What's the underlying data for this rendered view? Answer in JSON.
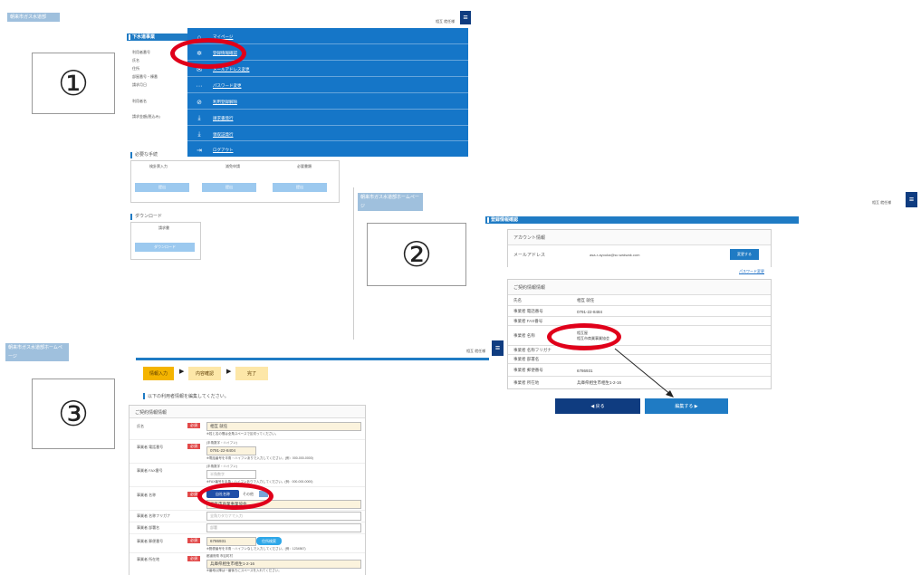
{
  "panel1": {
    "logo": "朝来市ガス水道部",
    "user_text": "相互 就任様",
    "number_label": "①",
    "contract_section_title": "下水道事業",
    "field_labels": [
      "利用者番号",
      "氏名",
      "住所",
      "部屋番号・棟番",
      "請求月日",
      "利用者名",
      "請求金額(税込み)"
    ],
    "menu": [
      {
        "icon": "home-icon",
        "glyph": "⌂",
        "label": "マイページ"
      },
      {
        "icon": "gear-icon",
        "glyph": "✲",
        "label": "登録情報確認"
      },
      {
        "icon": "mail-icon",
        "glyph": "✉",
        "label": "メールアドレス変更"
      },
      {
        "icon": "dots-icon",
        "glyph": "···",
        "label": "パスワード変更"
      },
      {
        "icon": "ban-icon",
        "glyph": "⊘",
        "label": "利用登録解除"
      },
      {
        "icon": "download-icon",
        "glyph": "⤓",
        "label": "請求書発行"
      },
      {
        "icon": "download-icon",
        "glyph": "⤓",
        "label": "領収証発行"
      },
      {
        "icon": "logout-icon",
        "glyph": "⇥",
        "label": "ログアウト"
      }
    ],
    "procedures_title": "必要な手続",
    "procedures_cols": [
      "検針票入力",
      "減免申請",
      "必要書類"
    ],
    "procedures_buttons": [
      "提出",
      "提出",
      "提出"
    ],
    "download_title": "ダウンロード",
    "download_col": "請求書",
    "download_button": "ダウンロード"
  },
  "panel2": {
    "logo": "朝来市ガス水道部ホームページ",
    "user_text": "相互 就任様",
    "number_label": "②",
    "title": "登録情報確認",
    "account_section": "アカウント情報",
    "email_label": "メールアドレス",
    "email_value": "asa-r-ayouka@sc.wakwak.com",
    "change_button": "変更する",
    "password_link": "パスワード変更",
    "contract_section": "ご契約情報情報",
    "rows": [
      {
        "label": "氏名",
        "value": "相互 就任"
      },
      {
        "label": "事業者 電話番号",
        "value": "0791-22-8484"
      },
      {
        "label": "事業者 FAX番号",
        "value": ""
      },
      {
        "label": "事業者 名称",
        "value": "相互屋\n相互市商業事業協会"
      },
      {
        "label": "事業者 名称フリガナ",
        "value": ""
      },
      {
        "label": "事業者 部署名",
        "value": ""
      },
      {
        "label": "事業者 郵便番号",
        "value": "6786931"
      },
      {
        "label": "事業者 所在地",
        "value": "兵庫県相生市相生1-2-16"
      }
    ],
    "back_button": "◀ 戻る",
    "edit_button": "編集する ▶"
  },
  "panel3": {
    "logo": "朝来市ガス水道部ホームページ",
    "user_text": "相互 就任様",
    "number_label": "③",
    "steps": [
      "情報入力",
      "内容確認",
      "完了"
    ],
    "instruction": "以下の利用者情報を編集してください。",
    "section": "ご契約情報情報",
    "required_label": "必須",
    "name_label": "氏名",
    "name_value": "相互 就任",
    "name_hint": "※姓と名の間は全角スペースで区切ってください。",
    "tel_label": "事業者 電話番号",
    "tel_sublabel": "(半角数字・ハイフン)",
    "tel_value": "0791-22-8404",
    "tel_hint": "※電話番号を半角・ハイフンありで入力してください。(例：000-000-0000)",
    "fax_label": "事業者 FAX番号",
    "fax_sublabel": "(半角数字・ハイフン)",
    "fax_placeholder": "半角数字",
    "fax_hint": "※FAX番号を半角・ハイフンありで入力してください。(例：000-000-0000)",
    "company_label": "事業者 名称",
    "company_radio_selected": "自社名称",
    "company_radio_other": "その他",
    "company_value": "相互市商業事業協会",
    "kana_label": "事業者 名称フリガナ",
    "kana_placeholder": "全角カタカナで入力",
    "dept_label": "事業者 部署名",
    "dept_placeholder": "部署",
    "zip_label": "事業者 郵便番号",
    "zip_value": "6786931",
    "zip_button": "住所検索",
    "zip_hint": "※郵便番号を半角・ハイフンなしで入力してください。(例：1234567)",
    "addr_label": "事業者 所在地",
    "addr_sublabel": "都道府県 市区町村",
    "addr_value": "兵庫県相生市相生1-2-16",
    "addr_hint": "※番地以降は一番後ろにスペースを入れてください。"
  }
}
